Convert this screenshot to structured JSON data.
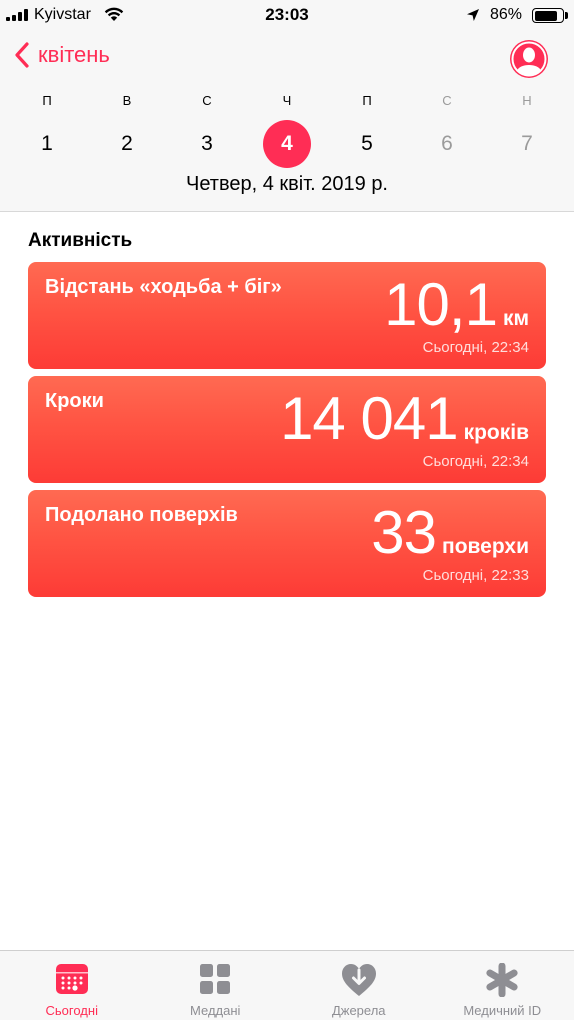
{
  "status_bar": {
    "carrier": "Kyivstar",
    "time": "23:03",
    "battery_percent_text": "86%",
    "battery_level": 0.86,
    "signal_bars": 4
  },
  "header": {
    "back_label": "квітень",
    "accent_color": "#ff2d55",
    "days": [
      {
        "letter": "П",
        "number": "1",
        "selected": false,
        "dim": false
      },
      {
        "letter": "В",
        "number": "2",
        "selected": false,
        "dim": false
      },
      {
        "letter": "С",
        "number": "3",
        "selected": false,
        "dim": false
      },
      {
        "letter": "Ч",
        "number": "4",
        "selected": true,
        "dim": false
      },
      {
        "letter": "П",
        "number": "5",
        "selected": false,
        "dim": false
      },
      {
        "letter": "С",
        "number": "6",
        "selected": false,
        "dim": true
      },
      {
        "letter": "Н",
        "number": "7",
        "selected": false,
        "dim": true
      }
    ],
    "date_caption": "Четвер, 4 квіт. 2019 р."
  },
  "activity": {
    "title": "Активність",
    "card_color": "#ff5443",
    "cards": [
      {
        "title": "Відстань «ходьба + біг»",
        "value": "10,1",
        "unit": "км",
        "time": "Сьогодні, 22:34"
      },
      {
        "title": "Кроки",
        "value": "14 041",
        "unit": "кроків",
        "time": "Сьогодні, 22:34"
      },
      {
        "title": "Подолано поверхів",
        "value": "33",
        "unit": "поверхи",
        "time": "Сьогодні, 22:33"
      }
    ]
  },
  "tab_bar": {
    "tabs": [
      {
        "label": "Сьогодні",
        "icon": "calendar-icon",
        "active": true
      },
      {
        "label": "Меддані",
        "icon": "grid-icon",
        "active": false
      },
      {
        "label": "Джерела",
        "icon": "heart-download-icon",
        "active": false
      },
      {
        "label": "Медичний ID",
        "icon": "asterisk-icon",
        "active": false
      }
    ]
  }
}
